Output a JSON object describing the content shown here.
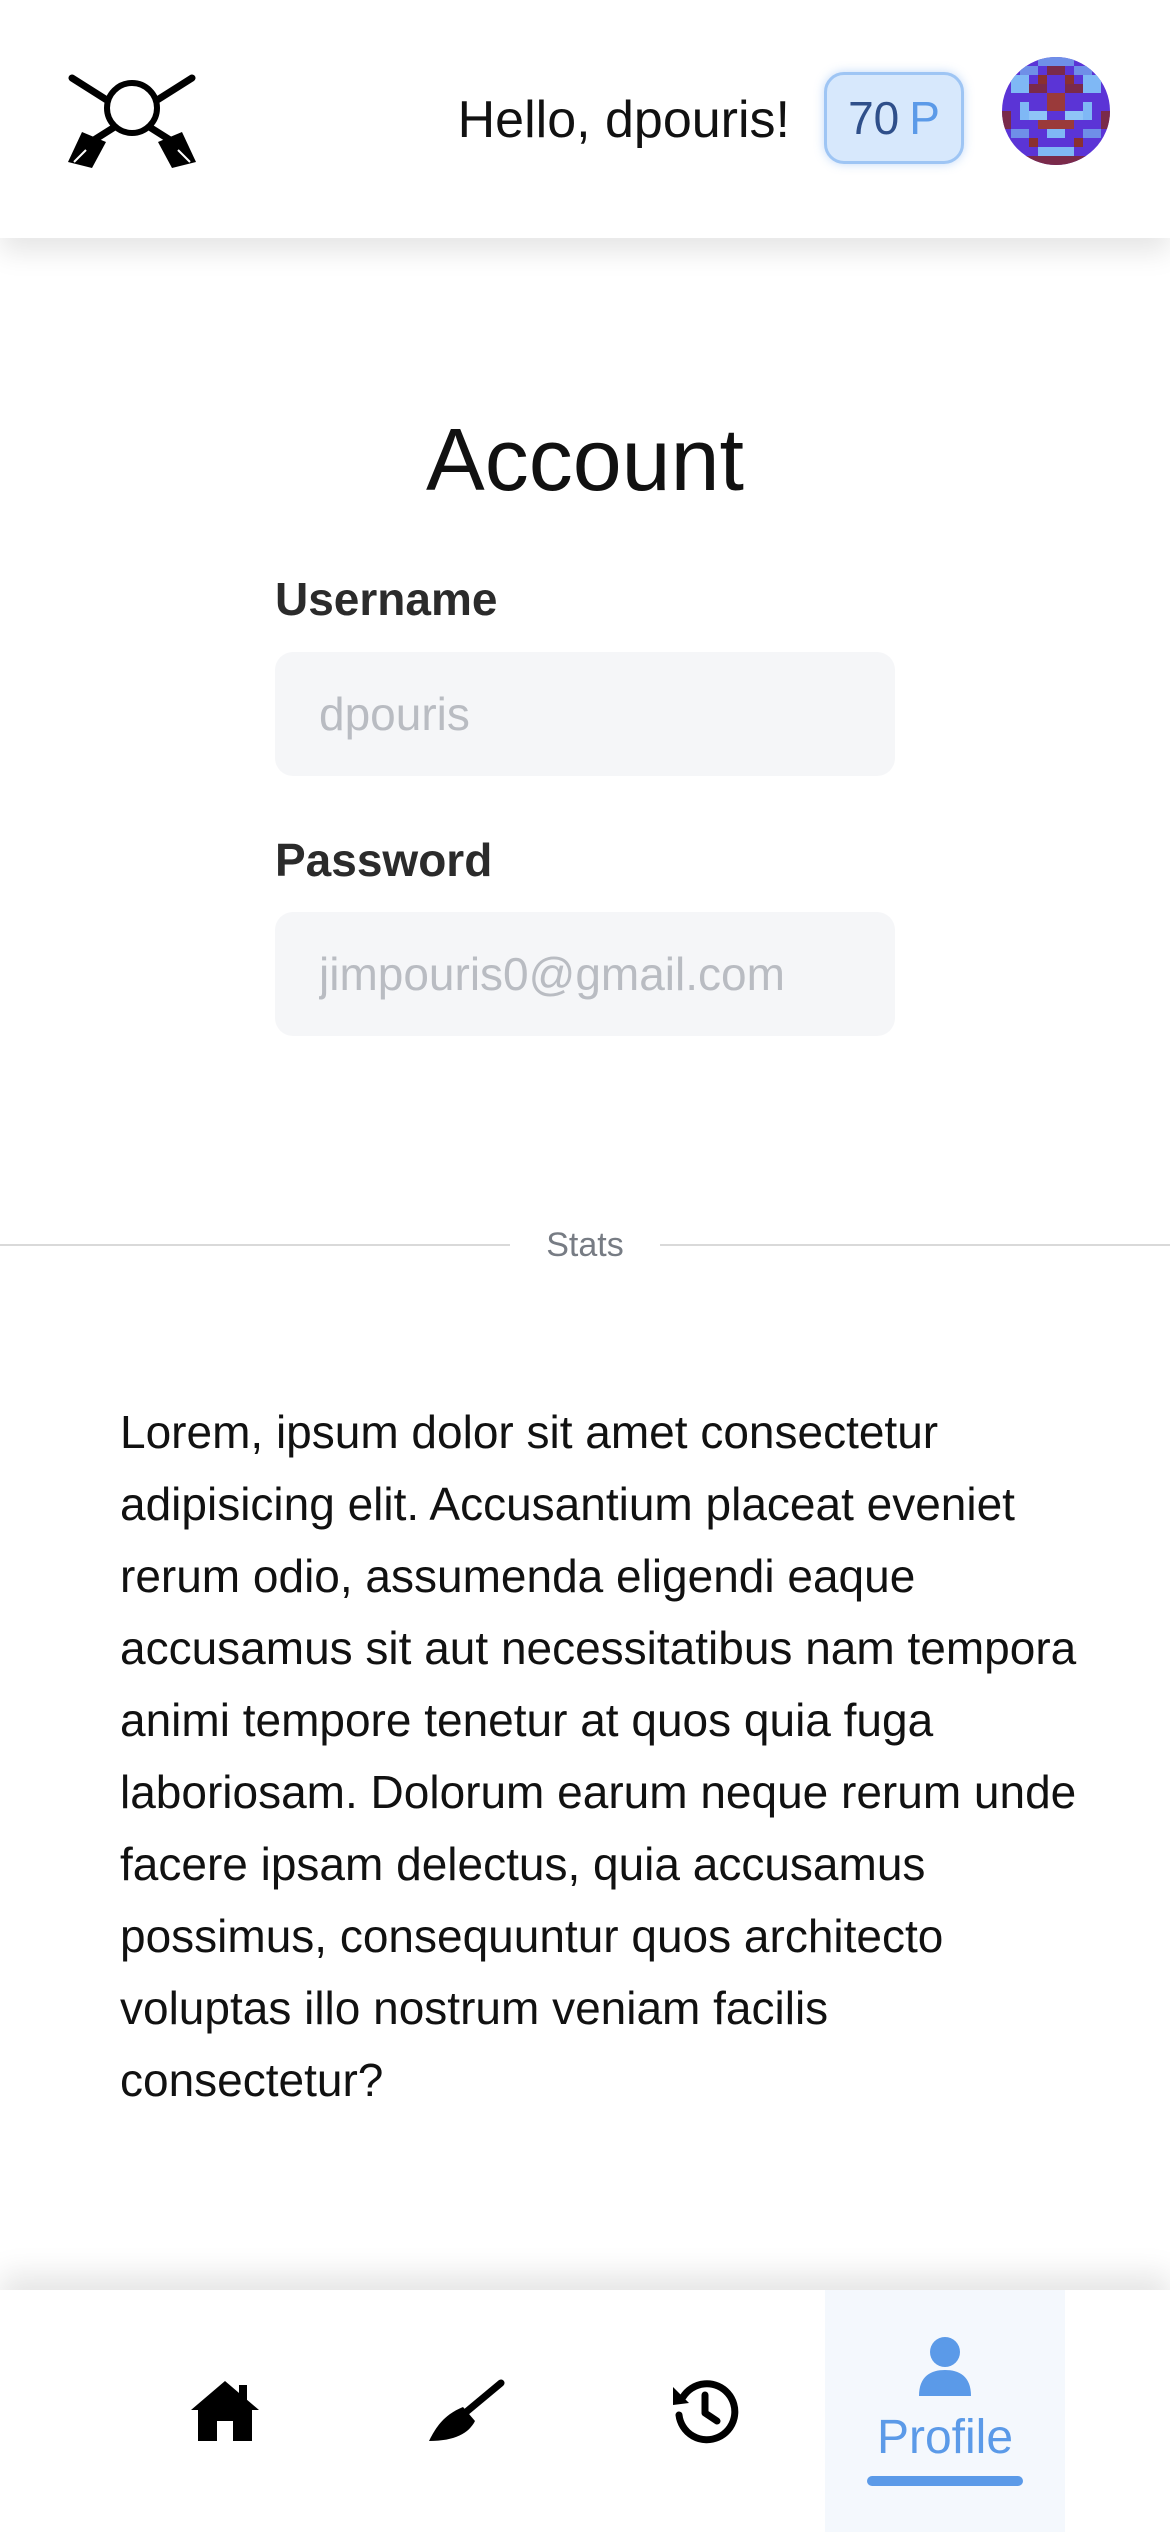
{
  "header": {
    "logo_icon": "crossed-brooms-logo-icon",
    "greeting": "Hello, dpouris!",
    "points": {
      "value": "70",
      "unit": "P",
      "accent_color": "#5b9ae8"
    },
    "avatar_icon": "pixel-avatar-icon"
  },
  "account": {
    "title": "Account",
    "username": {
      "label": "Username",
      "placeholder": "dpouris",
      "value": ""
    },
    "password": {
      "label": "Password",
      "placeholder": "jimpouris0@gmail.com",
      "value": ""
    }
  },
  "stats": {
    "divider_label": "Stats",
    "text": "Lorem, ipsum dolor sit amet consectetur adipisicing elit. Accusantium placeat eveniet rerum odio, assumenda eligendi eaque accusamus sit aut necessitatibus nam tempora animi tempore tenetur at quos quia fuga laboriosam. Dolorum earum neque rerum unde facere ipsam delectus, quia accusamus possimus, consequuntur quos architecto voluptas illo nostrum veniam facilis consectetur?"
  },
  "bottom_nav": {
    "items": [
      {
        "icon": "home-icon",
        "label": ""
      },
      {
        "icon": "broom-icon",
        "label": ""
      },
      {
        "icon": "history-icon",
        "label": ""
      },
      {
        "icon": "user-icon",
        "label": "Profile",
        "active": true
      }
    ],
    "active_color": "#5b9ae8"
  }
}
